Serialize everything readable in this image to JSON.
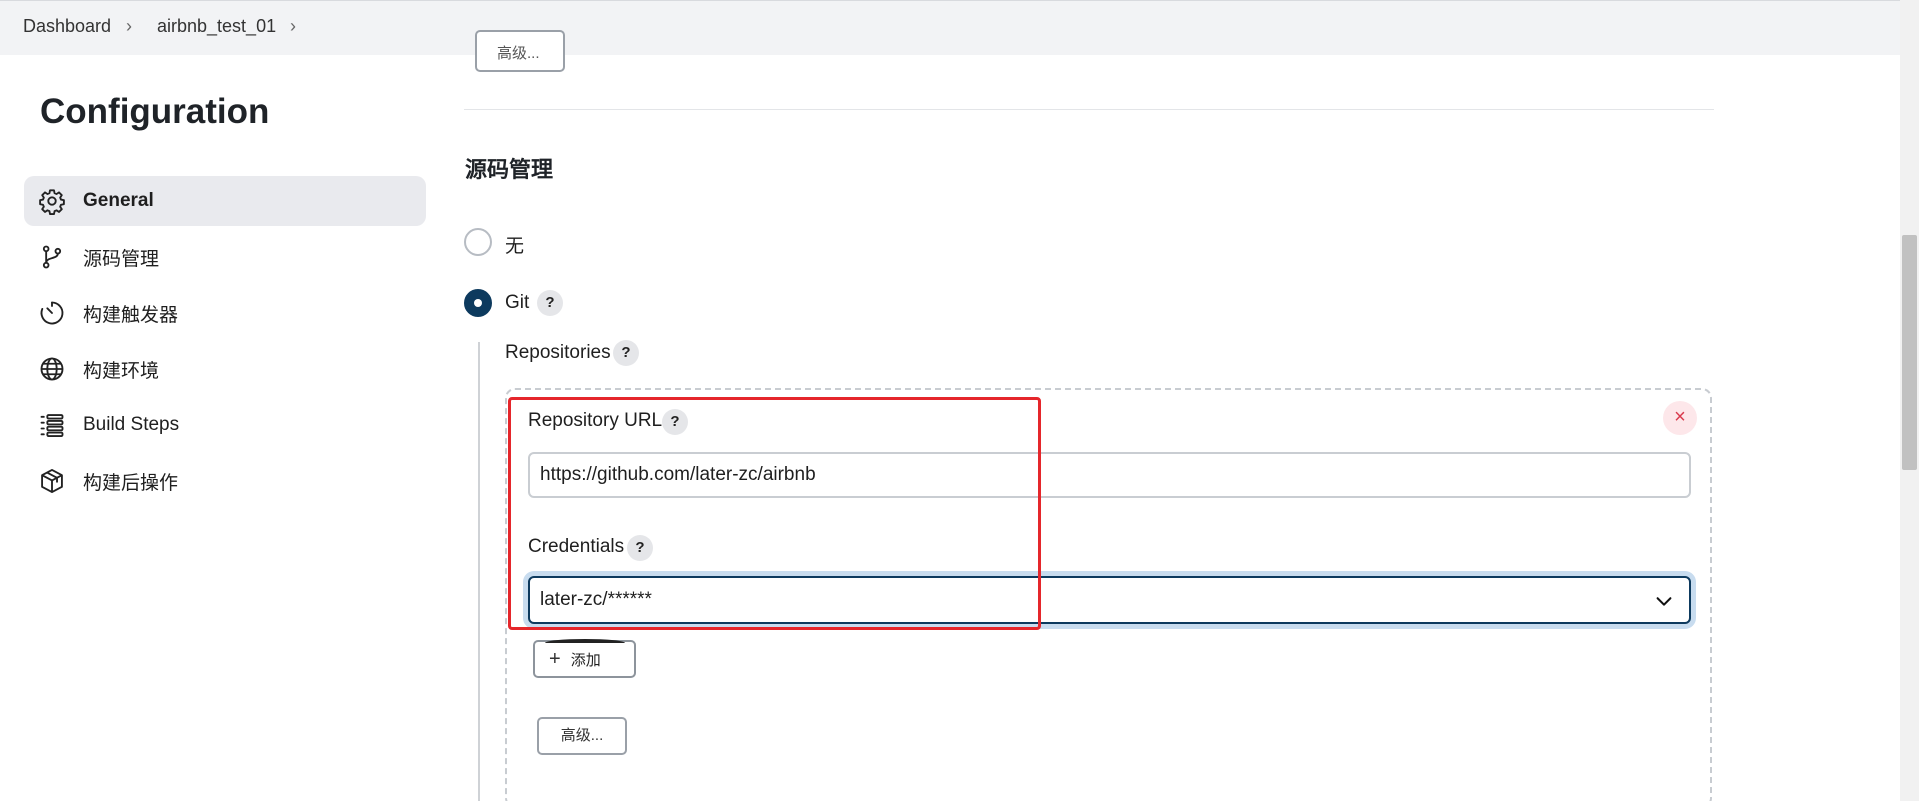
{
  "breadcrumb": {
    "items": [
      "Dashboard",
      "airbnb_test_01"
    ]
  },
  "page": {
    "title": "Configuration"
  },
  "sidebar": {
    "items": [
      {
        "label": "General",
        "icon": "gear-icon",
        "active": true
      },
      {
        "label": "源码管理",
        "icon": "git-branch-icon",
        "active": false
      },
      {
        "label": "构建触发器",
        "icon": "timer-icon",
        "active": false
      },
      {
        "label": "构建环境",
        "icon": "globe-icon",
        "active": false
      },
      {
        "label": "Build Steps",
        "icon": "list-icon",
        "active": false
      },
      {
        "label": "构建后操作",
        "icon": "package-icon",
        "active": false
      }
    ]
  },
  "main": {
    "partial_button_label": "高级...",
    "section_title": "源码管理",
    "scm_options": [
      {
        "label": "无",
        "checked": false
      },
      {
        "label": "Git",
        "checked": true
      }
    ],
    "help_glyph": "?",
    "repositories_label": "Repositories",
    "repository": {
      "url_label": "Repository URL",
      "url_value": "https://github.com/later-zc/airbnb",
      "credentials_label": "Credentials",
      "credentials_value": "later-zc/******",
      "add_button_label": "添加",
      "advanced_button_label": "高级...",
      "close_glyph": "×"
    }
  },
  "colors": {
    "accent": "#0d3a5e",
    "focus_ring": "#c8dcef",
    "highlight": "#e5262b",
    "sidebar_active_bg": "#e9eaee"
  }
}
